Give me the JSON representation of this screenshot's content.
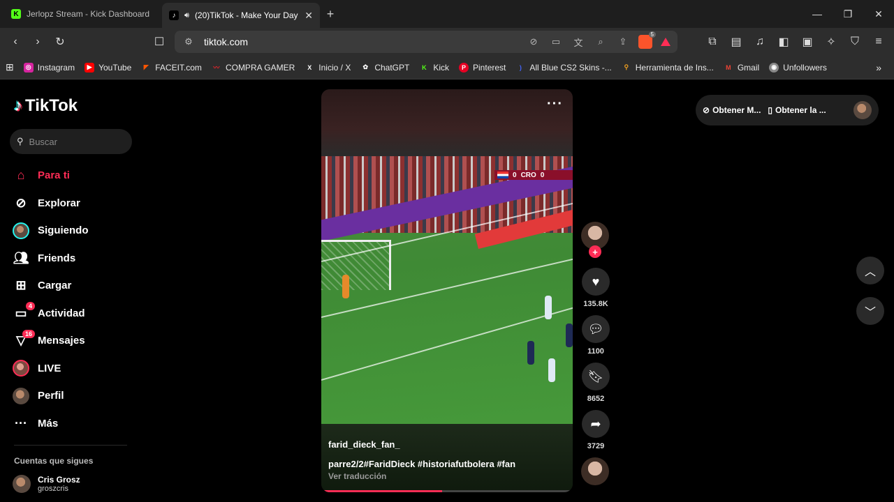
{
  "browser": {
    "tabs": [
      {
        "title": "Jerlopz Stream - Kick Dashboard",
        "icon": "kick-icon",
        "active": false
      },
      {
        "title": "(20)TikTok - Make Your Day",
        "icon": "tiktok-icon",
        "active": true,
        "audio": "speaker-icon"
      }
    ],
    "url": "tiktok.com",
    "brave_badge": "5",
    "bookmarks": [
      {
        "label": "Instagram",
        "icon": "instagram-icon",
        "color": "#d6249f"
      },
      {
        "label": "YouTube",
        "icon": "youtube-icon",
        "color": "#ff0000"
      },
      {
        "label": "FACEIT.com",
        "icon": "faceit-icon",
        "color": "#ff5500"
      },
      {
        "label": "COMPRA GAMER",
        "icon": "compragamer-icon",
        "color": "#e0242a"
      },
      {
        "label": "Inicio / X",
        "icon": "x-icon",
        "color": "#000000"
      },
      {
        "label": "ChatGPT",
        "icon": "chatgpt-icon",
        "color": "#555555"
      },
      {
        "label": "Kick",
        "icon": "kick-icon",
        "color": "#53fc18"
      },
      {
        "label": "Pinterest",
        "icon": "pinterest-icon",
        "color": "#e60023"
      },
      {
        "label": "All Blue CS2 Skins -...",
        "icon": "bracket-icon",
        "color": "#3355ff"
      },
      {
        "label": "Herramienta de Ins...",
        "icon": "search-icon",
        "color": "#f0a020"
      },
      {
        "label": "Gmail",
        "icon": "gmail-icon",
        "color": "#ea4335"
      },
      {
        "label": "Unfollowers",
        "icon": "unfollowers-icon",
        "color": "#888888"
      }
    ]
  },
  "tiktok": {
    "logo": "TikTok",
    "search_placeholder": "Buscar",
    "nav": [
      {
        "label": "Para ti",
        "icon": "home-icon",
        "active": true
      },
      {
        "label": "Explorar",
        "icon": "compass-icon"
      },
      {
        "label": "Siguiendo",
        "icon": "avatar-icon"
      },
      {
        "label": "Friends",
        "icon": "friends-icon"
      },
      {
        "label": "Cargar",
        "icon": "upload-icon"
      },
      {
        "label": "Actividad",
        "icon": "activity-icon",
        "badge": "4"
      },
      {
        "label": "Mensajes",
        "icon": "messages-icon",
        "badge": "16"
      },
      {
        "label": "LIVE",
        "icon": "live-icon"
      },
      {
        "label": "Perfil",
        "icon": "profile-avatar-icon"
      },
      {
        "label": "Más",
        "icon": "more-icon"
      }
    ],
    "following_heading": "Cuentas que sigues",
    "following": [
      {
        "name": "Cris Grosz",
        "handle": "groszcris"
      }
    ],
    "get_bar": {
      "item1": "Obtener M...",
      "item2": "Obtener la ..."
    },
    "video": {
      "author": "farid_dieck_fan_",
      "caption": "parre2/2#FaridDieck  #historiafutbolera  #fan",
      "translate": "Ver traducción",
      "scoreboard": {
        "home": "0",
        "away": "0",
        "team": "CRO"
      },
      "progress": 0.48
    },
    "actions": {
      "likes": "135.8K",
      "comments": "1100",
      "saves": "8652",
      "shares": "3729"
    },
    "colors": {
      "accent": "#fe2c55"
    }
  }
}
